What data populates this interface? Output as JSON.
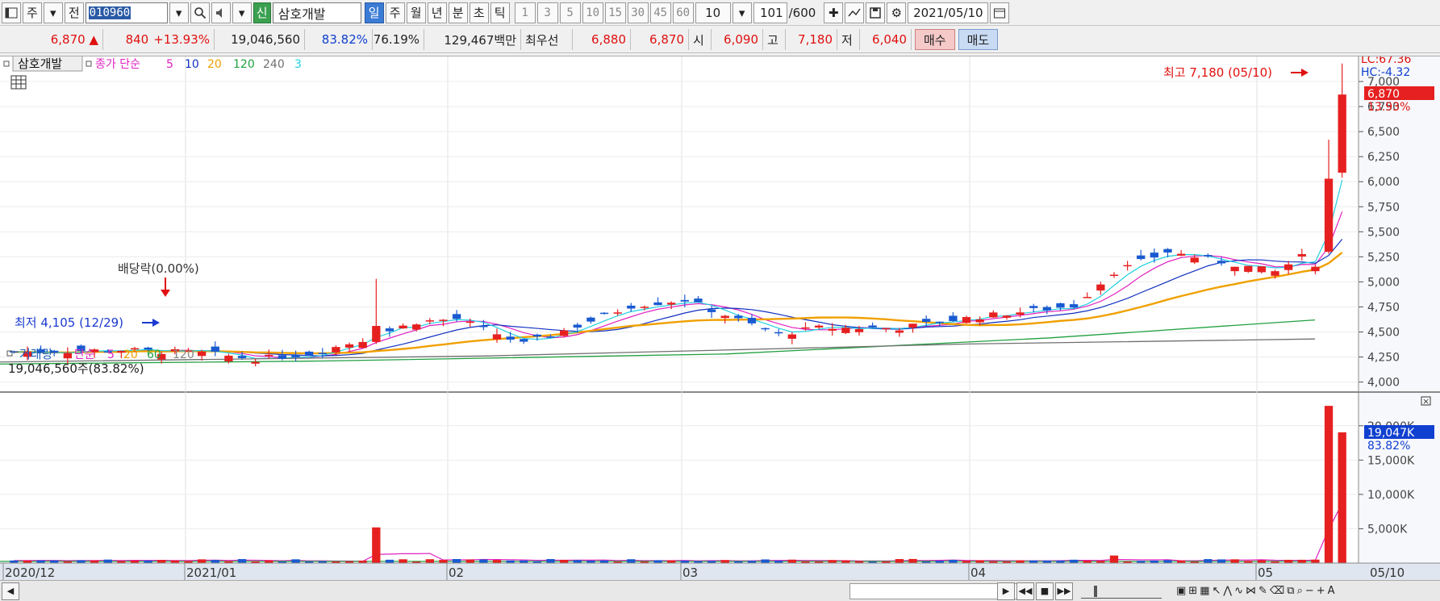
{
  "toolbar": {
    "market_tab": "주",
    "prev_label": "전",
    "stock_code": "010960",
    "new_badge": "신",
    "stock_name": "삼호개발",
    "periods": [
      "일",
      "주",
      "월",
      "년",
      "분",
      "초",
      "틱"
    ],
    "active_period": "일",
    "intervals": [
      "1",
      "3",
      "5",
      "10",
      "15",
      "30",
      "45",
      "60"
    ],
    "interval_value": "10",
    "count_value": "101",
    "count_total": "/600",
    "date_value": "2021/05/10"
  },
  "quote": {
    "price": "6,870",
    "direction": "▲",
    "change": "840",
    "change_pct": "+13.93%",
    "volume": "19,046,560",
    "volume_ratio": "83.82%",
    "turnover": "76.19%",
    "amount": "129,467백만",
    "best_label": "최우선",
    "best_ask": "6,880",
    "best_bid": "6,870",
    "open_label": "시",
    "open": "6,090",
    "high_label": "고",
    "high": "7,180",
    "low_label": "저",
    "low": "6,040",
    "buy_label": "매수",
    "sell_label": "매도"
  },
  "price_panel": {
    "title": "삼호개발",
    "legend_prefix": "종가 단순",
    "ma_labels": [
      "5",
      "10",
      "20",
      "120",
      "240",
      "3"
    ],
    "ma_colors": [
      "#e020c0",
      "#1030c0",
      "#f0a000",
      "#20a040",
      "#707070",
      "#20d0e0"
    ],
    "lc": "LC:67.36",
    "hc": "HC:-4.32",
    "current_price_tag": "6,870",
    "current_pct_tag": "13.93%",
    "high_annotation": "최고 7,180 (05/10)",
    "low_annotation": "최저 4,105 (12/29)",
    "dividend_annotation": "배당락(0.00%)",
    "y_ticks": [
      "7,000",
      "6,750",
      "6,500",
      "6,250",
      "6,000",
      "5,750",
      "5,500",
      "5,250",
      "5,000",
      "4,750",
      "4,500",
      "4,250",
      "4,000"
    ]
  },
  "volume_panel": {
    "title": "거래량",
    "legend_prefix": "단순",
    "ma_labels": [
      "5",
      "20",
      "60",
      "120"
    ],
    "info": "19,046,560주(83.82%)",
    "volume_tag": "19,047K",
    "pct_tag": "83.82%",
    "y_ticks": [
      "20,000K",
      "15,000K",
      "10,000K",
      "5,000K"
    ]
  },
  "x_axis": {
    "labels": [
      "2020/12",
      "2021/01",
      "02",
      "03",
      "04",
      "05"
    ],
    "right_label": "05/10"
  },
  "chart_data": {
    "type": "candlestick",
    "title": "삼호개발",
    "ylim": [
      3900,
      7250
    ],
    "y_ticks": [
      4000,
      4250,
      4500,
      4750,
      5000,
      5250,
      5500,
      5750,
      6000,
      6250,
      6500,
      6750,
      7000
    ],
    "volume_ylim": [
      0,
      23500
    ],
    "volume_ticks_k": [
      5000,
      10000,
      15000,
      20000
    ],
    "last": {
      "date": "2021/05/10",
      "open": 6090,
      "high": 7180,
      "low": 6040,
      "close": 6870,
      "volume_k": 19047
    },
    "prev_close": 6030,
    "prev_volume_k": 22900,
    "period_high": {
      "date": "05/10",
      "value": 7180
    },
    "period_low": {
      "date": "12/29",
      "value": 4105
    }
  }
}
